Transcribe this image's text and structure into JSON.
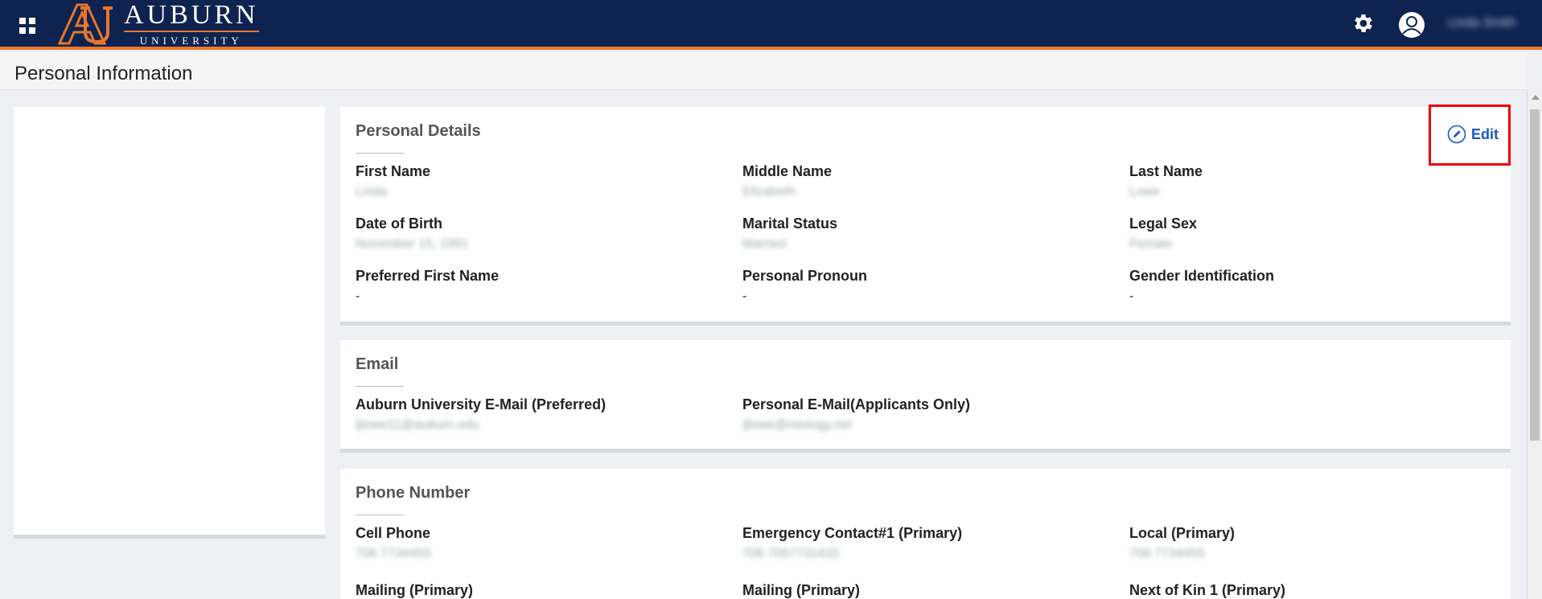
{
  "header": {
    "logo_word": "AUBURN",
    "logo_sub": "UNIVERSITY",
    "user_name": "Linda Smith",
    "brand_color": "#0e2350",
    "accent_color": "#e8772e"
  },
  "page": {
    "title": "Personal Information"
  },
  "personal_details": {
    "title": "Personal Details",
    "edit_label": "Edit",
    "fields": [
      {
        "label": "First Name",
        "value": "Linda"
      },
      {
        "label": "Middle Name",
        "value": "Elizabeth"
      },
      {
        "label": "Last Name",
        "value": "Lowe"
      },
      {
        "label": "Date of Birth",
        "value": "November 15, 1991"
      },
      {
        "label": "Marital Status",
        "value": "Married"
      },
      {
        "label": "Legal Sex",
        "value": "Female"
      },
      {
        "label": "Preferred First Name",
        "value": "-"
      },
      {
        "label": "Personal Pronoun",
        "value": "-"
      },
      {
        "label": "Gender Identification",
        "value": "-"
      }
    ]
  },
  "email": {
    "title": "Email",
    "fields": [
      {
        "label": "Auburn University E-Mail (Preferred)",
        "value": "ljlowe11@auburn.edu"
      },
      {
        "label": "Personal E-Mail(Applicants Only)",
        "value": "ljlowe@mixlogy.net"
      }
    ]
  },
  "phone": {
    "title": "Phone Number",
    "fields": [
      {
        "label": "Cell Phone",
        "value": "706 7734455"
      },
      {
        "label": "Emergency Contact#1 (Primary)",
        "value": "706 7067731433"
      },
      {
        "label": "Local (Primary)",
        "value": "706 7734455"
      },
      {
        "label": "Mailing (Primary)",
        "value": ""
      },
      {
        "label": "Mailing (Primary)",
        "value": ""
      },
      {
        "label": "Next of Kin 1 (Primary)",
        "value": ""
      }
    ]
  }
}
